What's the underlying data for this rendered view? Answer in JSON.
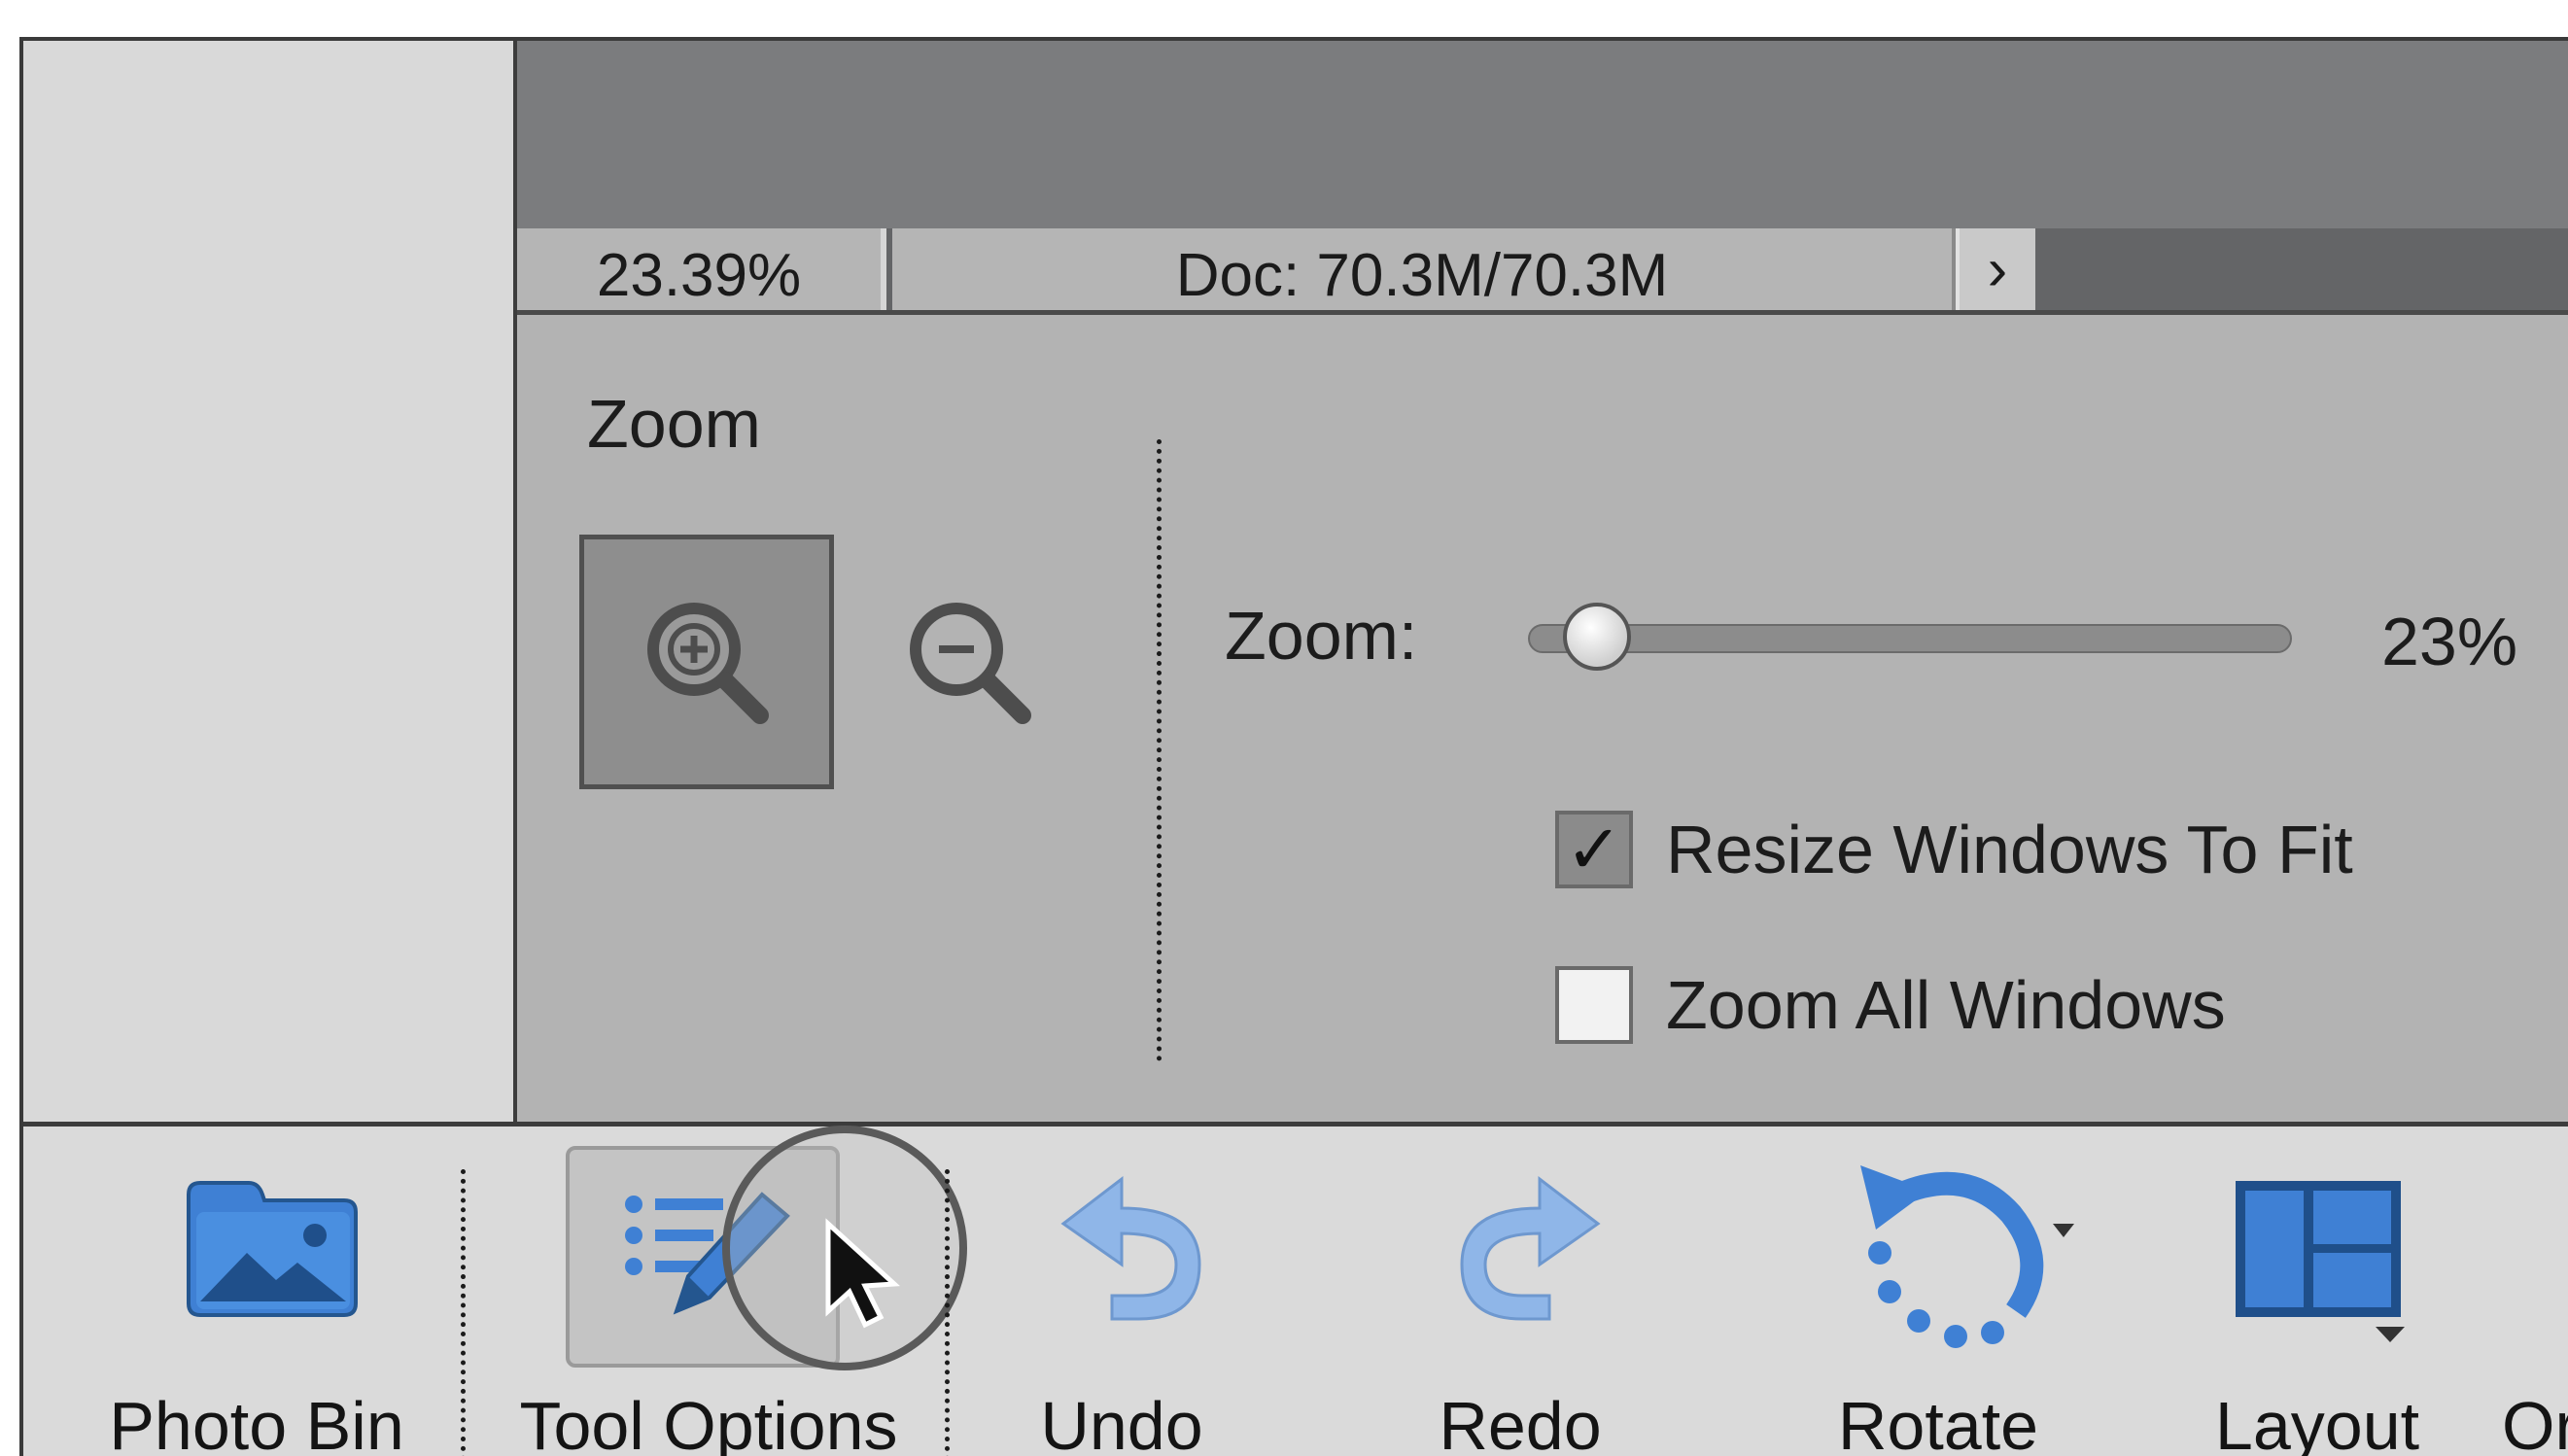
{
  "status_bar": {
    "zoom_percent": "23.39%",
    "doc_size": "Doc: 70.3M/70.3M",
    "arrow_glyph": "›"
  },
  "tool_options": {
    "section_title": "Zoom",
    "zoom_in_icon": "zoom-in-icon",
    "zoom_out_icon": "zoom-out-icon",
    "zoom_label": "Zoom:",
    "zoom_value": "23%",
    "zoom_slider_fraction": 0.05,
    "resize_windows": {
      "label": "Resize Windows To Fit",
      "checked": true,
      "check_glyph": "✓"
    },
    "zoom_all_windows": {
      "label": "Zoom All Windows",
      "checked": false
    }
  },
  "taskbar": {
    "items": [
      {
        "label": "Photo Bin",
        "icon": "folder-photo-icon"
      },
      {
        "label": "Tool Options",
        "icon": "tool-options-icon",
        "active": true
      },
      {
        "label": "Undo",
        "icon": "undo-icon"
      },
      {
        "label": "Redo",
        "icon": "redo-icon"
      },
      {
        "label": "Rotate",
        "icon": "rotate-icon"
      },
      {
        "label": "Layout",
        "icon": "layout-icon"
      },
      {
        "label": "Or",
        "icon": "organizer-icon"
      }
    ]
  },
  "colors": {
    "accent_blue": "#3f7fcf",
    "panel_gray": "#b3b3b3",
    "taskbar_gray": "#dadada"
  }
}
